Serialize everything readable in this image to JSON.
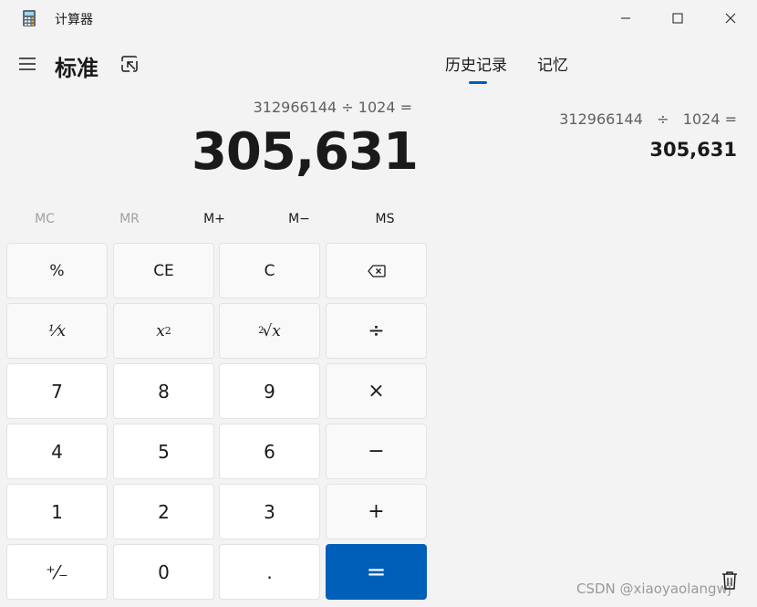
{
  "window": {
    "title": "计算器",
    "icons": {
      "app": "calculator-app-icon",
      "minimize": "minimize-icon",
      "maximize": "maximize-icon",
      "close": "close-icon"
    }
  },
  "header": {
    "mode_title": "标准",
    "icons": {
      "menu": "hamburger-menu-icon",
      "keep_on_top": "keep-on-top-icon"
    }
  },
  "display": {
    "expression": "312966144 ÷ 1024 =",
    "result": "305,631"
  },
  "memory": {
    "mc": "MC",
    "mr": "MR",
    "mplus": "M+",
    "mminus": "M−",
    "ms": "MS"
  },
  "keypad": {
    "percent": "%",
    "ce": "CE",
    "c": "C",
    "backspace_icon": "backspace-icon",
    "reciprocal": "¹⁄x",
    "square_base": "x",
    "square_exp": "2",
    "sqrt_index": "2",
    "sqrt_sign": "√x",
    "divide": "÷",
    "seven": "7",
    "eight": "8",
    "nine": "9",
    "multiply": "×",
    "four": "4",
    "five": "5",
    "six": "6",
    "minus": "−",
    "one": "1",
    "two": "2",
    "three": "3",
    "plus": "+",
    "negate": "⁺⁄₋",
    "zero": "0",
    "decimal": ".",
    "equals": "="
  },
  "side_panel": {
    "tabs": {
      "history": "历史记录",
      "memory": "记忆"
    },
    "active_tab": "history",
    "history": [
      {
        "expression": "312966144   ÷   1024 =",
        "result": "305,631"
      }
    ],
    "trash_icon": "trash-icon"
  },
  "watermark": "CSDN @xiaoyaolangwj",
  "colors": {
    "accent": "#005fb8",
    "background": "#f3f3f3",
    "key_number": "#ffffff",
    "key_operator": "#f9f9f9"
  }
}
